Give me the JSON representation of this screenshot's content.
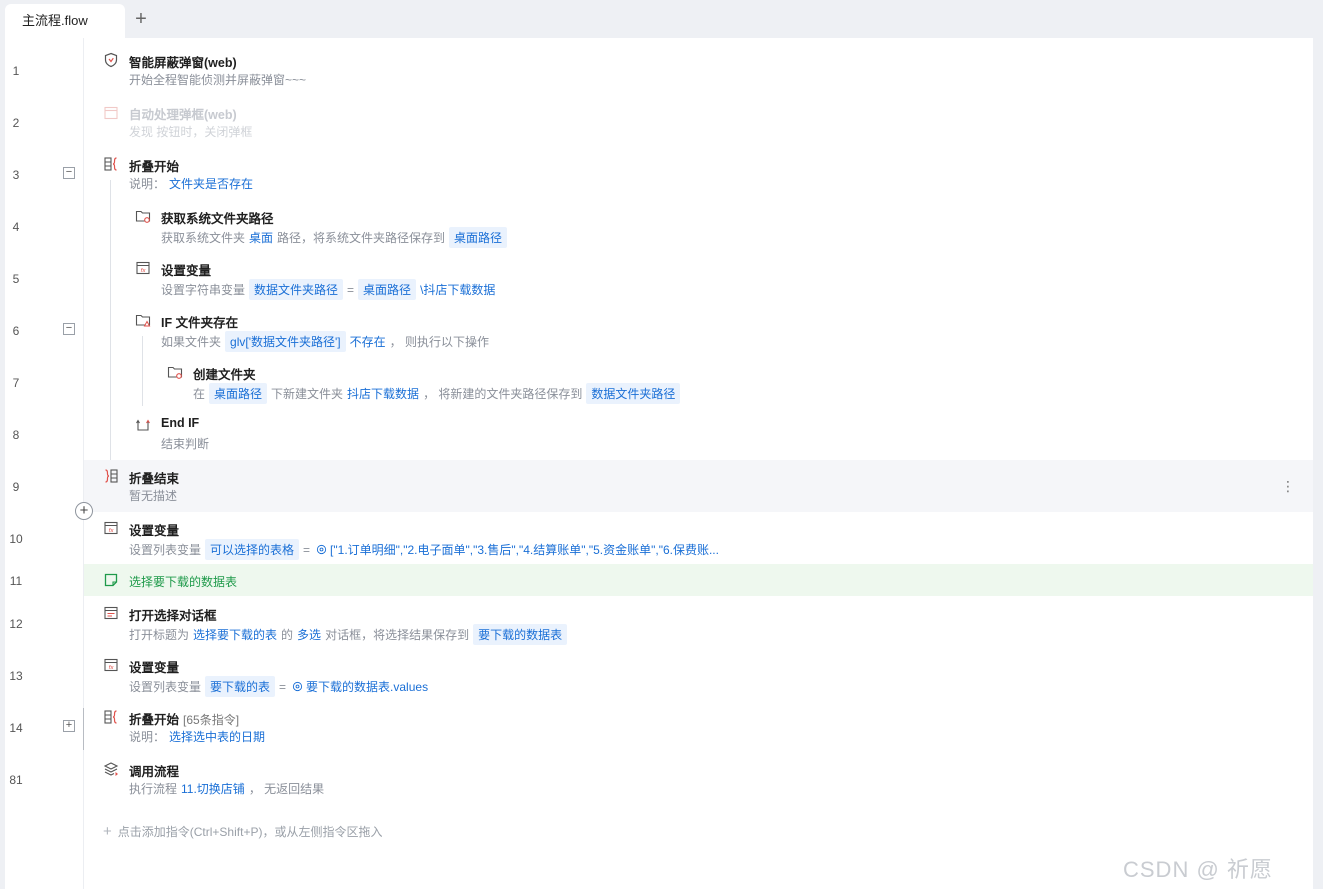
{
  "tabs": [
    {
      "label": "主流程.flow"
    }
  ],
  "tab_add": "+",
  "rows": [
    {
      "line": "1",
      "title": "智能屏蔽弹窗(web)",
      "desc": "开始全程智能侦测并屏蔽弹窗~~~",
      "icon": "shield-icon"
    },
    {
      "line": "2",
      "title": "自动处理弹框(web)",
      "desc": "发现 按钮时，关闭弹框",
      "icon": "popup-window-icon",
      "disabled": true
    },
    {
      "line": "3",
      "title": "折叠开始",
      "desc_prefix": "说明：",
      "desc_value": "文件夹是否存在",
      "icon": "fold-start-icon",
      "fold": "−"
    },
    {
      "line": "4",
      "title": "获取系统文件夹路径",
      "desc_a": "获取系统文件夹",
      "desc_b": "桌面",
      "desc_c": "路径，将系统文件夹路径保存到",
      "chip": "桌面路径",
      "icon": "folder-gear-icon"
    },
    {
      "line": "5",
      "title": "设置变量",
      "desc_a": "设置字符串变量",
      "chip1": "数据文件夹路径",
      "eq": "=",
      "chip2": "桌面路径",
      "tail": "\\抖店下载数据",
      "icon": "variable-icon"
    },
    {
      "line": "6",
      "title": "IF 文件夹存在",
      "desc_a": "如果文件夹",
      "chip": "glv['数据文件夹路径']",
      "desc_b": "不存在",
      "desc_c": "，  则执行以下操作",
      "icon": "folder-if-icon",
      "fold": "−"
    },
    {
      "line": "7",
      "title": "创建文件夹",
      "desc_a": "在",
      "chip1": "桌面路径",
      "desc_b": "下新建文件夹",
      "desc_c": "抖店下载数据",
      "desc_d": "，  将新建的文件夹路径保存到",
      "chip2": "数据文件夹路径",
      "icon": "folder-create-icon"
    },
    {
      "line": "8",
      "title": "End IF",
      "desc": "结束判断",
      "icon": "end-if-icon"
    },
    {
      "line": "9",
      "title": "折叠结束",
      "desc": "暂无描述",
      "icon": "fold-end-icon",
      "more": "⋮"
    },
    {
      "line": "10",
      "title": "设置变量",
      "desc_a": "设置列表变量",
      "chip": "可以选择的表格",
      "eq": "=",
      "tail": "[\"1.订单明细\",\"2.电子面单\",\"3.售后\",\"4.结算账单\",\"5.资金账单\",\"6.保费账...",
      "icon": "variable-icon"
    },
    {
      "line": "11",
      "title": "选择要下载的数据表",
      "icon": "note-icon"
    },
    {
      "line": "12",
      "title": "打开选择对话框",
      "desc_a": "打开标题为",
      "desc_b": "选择要下载的表",
      "desc_c": "的",
      "desc_d": "多选",
      "desc_e": "对话框，将选择结果保存到",
      "chip": "要下载的数据表",
      "icon": "dialog-icon"
    },
    {
      "line": "13",
      "title": "设置变量",
      "desc_a": "设置列表变量",
      "chip": "要下载的表",
      "eq": "=",
      "tail": "要下载的数据表.values",
      "icon": "variable-icon"
    },
    {
      "line": "14",
      "title": "折叠开始",
      "count": "[65条指令]",
      "desc_prefix": "说明：",
      "desc_value": "选择选中表的日期",
      "icon": "fold-start-icon",
      "fold": "+"
    },
    {
      "line": "81",
      "title": "调用流程",
      "desc_a": "执行流程",
      "desc_b": "11.切换店铺",
      "desc_c": "，  无返回结果",
      "icon": "layers-icon"
    }
  ],
  "add_hint": "点击添加指令(Ctrl+Shift+P)，或从左侧指令区拖入",
  "add_row_button": "+",
  "watermark": "CSDN @  祈愿",
  "colors": {
    "accent": "#1a6fd6",
    "chip_bg": "#eaf2fd",
    "note_green": "#1e9a4a",
    "icon_red": "#e0524c"
  }
}
